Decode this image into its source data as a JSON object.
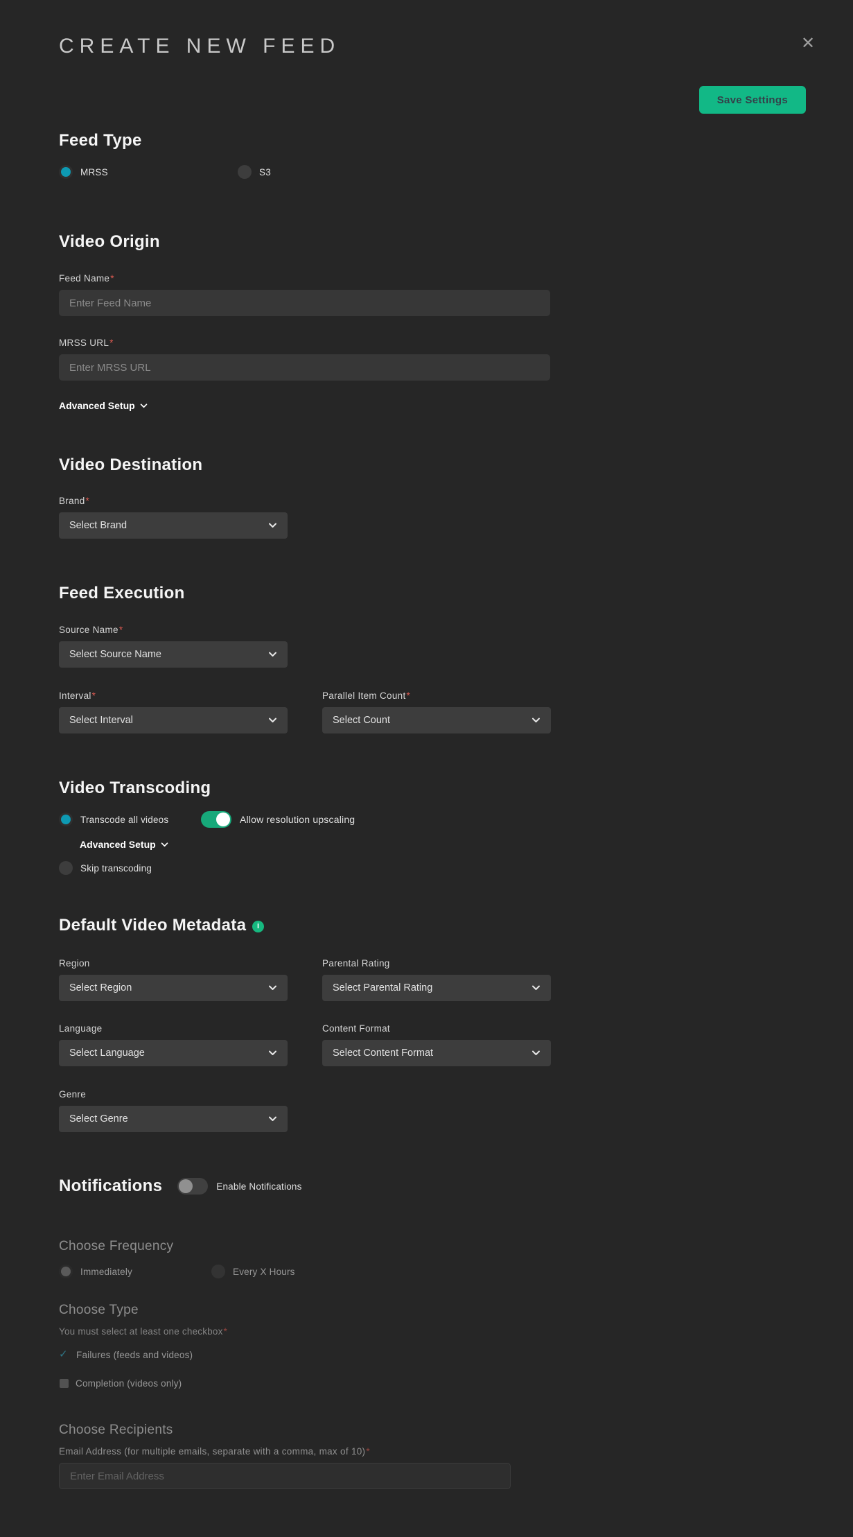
{
  "colors": {
    "accent_cyan": "#0e9ab3",
    "accent_green": "#12b886",
    "required_red": "#e05b52",
    "background": "#262626"
  },
  "required_mark": "*",
  "header": {
    "title": "CREATE NEW FEED",
    "save_button": "Save Settings"
  },
  "feed_type": {
    "heading": "Feed Type",
    "options": [
      {
        "label": "MRSS",
        "selected": true
      },
      {
        "label": "S3",
        "selected": false
      }
    ]
  },
  "video_origin": {
    "heading": "Video Origin",
    "feed_name": {
      "label": "Feed Name",
      "placeholder": "Enter Feed Name",
      "value": ""
    },
    "mrss_url": {
      "label": "MRSS URL",
      "placeholder": "Enter MRSS URL",
      "value": ""
    },
    "advanced_setup_label": "Advanced Setup"
  },
  "video_destination": {
    "heading": "Video Destination",
    "brand": {
      "label": "Brand",
      "selected_value": "Select Brand"
    }
  },
  "feed_execution": {
    "heading": "Feed Execution",
    "source_name": {
      "label": "Source Name",
      "selected_value": "Select Source Name"
    },
    "interval": {
      "label": "Interval",
      "selected_value": "Select Interval"
    },
    "parallel_item_count": {
      "label": "Parallel Item Count",
      "selected_value": "Select Count"
    }
  },
  "video_transcoding": {
    "heading": "Video Transcoding",
    "transcode_all_label": "Transcode all videos",
    "transcode_all_selected": true,
    "upscaling_label": "Allow resolution upscaling",
    "upscaling_enabled": true,
    "advanced_setup_label": "Advanced Setup",
    "skip_label": "Skip transcoding",
    "skip_selected": false
  },
  "default_video_metadata": {
    "heading": "Default Video Metadata",
    "info_icon_glyph": "i",
    "region": {
      "label": "Region",
      "selected_value": "Select Region"
    },
    "parental_rating": {
      "label": "Parental Rating",
      "selected_value": "Select Parental Rating"
    },
    "language": {
      "label": "Language",
      "selected_value": "Select Language"
    },
    "content_format": {
      "label": "Content Format",
      "selected_value": "Select Content Format"
    },
    "genre": {
      "label": "Genre",
      "selected_value": "Select Genre"
    }
  },
  "notifications": {
    "heading": "Notifications",
    "toggle_label": "Enable Notifications",
    "enabled": false,
    "frequency": {
      "heading": "Choose Frequency",
      "options": [
        {
          "label": "Immediately",
          "selected": true
        },
        {
          "label": "Every X Hours",
          "selected": false
        }
      ]
    },
    "type": {
      "heading": "Choose Type",
      "hint": "You must select at least one checkbox",
      "checkboxes": [
        {
          "label": "Failures (feeds and videos)",
          "checked": true
        },
        {
          "label": "Completion (videos only)",
          "checked": false
        }
      ],
      "check_glyph": "✓"
    },
    "recipients": {
      "heading": "Choose Recipients",
      "email": {
        "label": "Email Address (for multiple emails, separate with a comma, max of 10)",
        "placeholder": "Enter Email Address",
        "value": ""
      }
    }
  }
}
